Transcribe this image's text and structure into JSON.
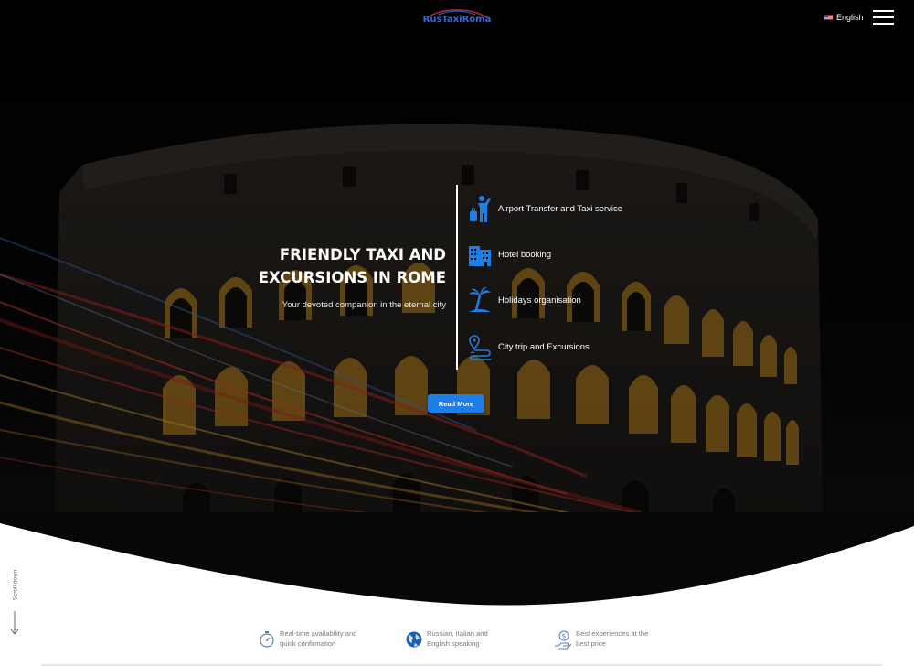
{
  "header": {
    "logo_text": "RusTaxiRoma",
    "language_label": "English",
    "flag_icon": "us-flag-icon",
    "menu_icon": "hamburger-menu-icon"
  },
  "hero": {
    "title_line1": "FRIENDLY TAXI AND",
    "title_line2": "EXCURSIONS IN ROME",
    "subtitle": "Your devoted companion in the eternal city",
    "services": [
      {
        "label": "Airport Transfer and Taxi service",
        "icon": "traveler-luggage-icon"
      },
      {
        "label": "Hotel booking",
        "icon": "hotel-building-icon"
      },
      {
        "label": "Holidays organisation",
        "icon": "palm-tree-icon"
      },
      {
        "label": "City trip and Excursions",
        "icon": "map-route-icon"
      }
    ],
    "cta_label": "Read More",
    "accent_color": "#1f7ee6"
  },
  "scroll": {
    "label": "Scroll down",
    "icon": "arrow-down-icon"
  },
  "features": [
    {
      "text": "Real-time availability and\nquick confirmation",
      "icon": "stopwatch-icon"
    },
    {
      "text": "Russian, Italian and\nEnglish speaking",
      "icon": "globe-icon"
    },
    {
      "text": "Best experiences at the\nbest price",
      "icon": "hand-dollar-icon"
    }
  ]
}
